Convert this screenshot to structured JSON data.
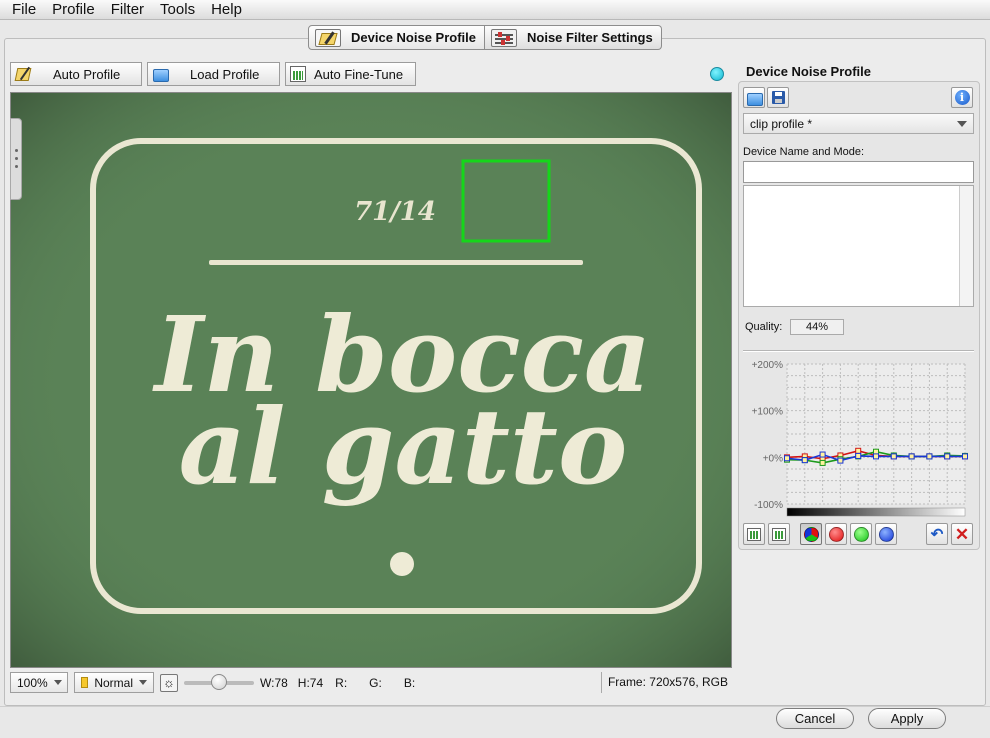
{
  "menu": [
    "File",
    "Profile",
    "Filter",
    "Tools",
    "Help"
  ],
  "tabs": [
    {
      "label": "Device Noise Profile",
      "icon": "device-profile-icon",
      "selected": true
    },
    {
      "label": "Noise Filter Settings",
      "icon": "sliders-icon",
      "selected": false
    }
  ],
  "toolbar": {
    "auto_profile": "Auto Profile",
    "load_profile": "Load Profile",
    "auto_fine_tune": "Auto Fine-Tune"
  },
  "status_dot_color": "#10b6d0",
  "viewer": {
    "image_text": {
      "fraction": "71/14",
      "line1": "In bocca",
      "line2": "al gatto"
    },
    "zoom": "100%",
    "mode": "Normal",
    "brightness_slider": 0.5,
    "sample_width": "W:78",
    "sample_height": "H:74",
    "r_label": "R:",
    "g_label": "G:",
    "b_label": "B:",
    "frame_info": "Frame: 720x576, RGB"
  },
  "panel": {
    "title": "Device Noise Profile",
    "profile_select": "clip profile *",
    "device_label": "Device Name and Mode:",
    "device_value": "",
    "notes_value": "",
    "quality_label": "Quality:",
    "quality_value": "44%"
  },
  "chart_data": {
    "type": "line",
    "y_tick_labels": [
      "+200%",
      "+100%",
      "+0%",
      "-100%"
    ],
    "ylim": [
      -100,
      200
    ],
    "grid": true,
    "x": [
      0,
      1,
      2,
      3,
      4,
      5,
      6,
      7,
      8,
      9,
      10
    ],
    "series": [
      {
        "color": "#d01515",
        "values": [
          0,
          2,
          -3,
          4,
          14,
          4,
          2,
          2,
          2,
          2,
          2
        ]
      },
      {
        "color": "#1c9a1c",
        "values": [
          -5,
          -6,
          -12,
          -4,
          2,
          12,
          4,
          2,
          2,
          4,
          3
        ]
      },
      {
        "color": "#1a36d8",
        "values": [
          -2,
          -6,
          6,
          -7,
          3,
          2,
          2,
          2,
          2,
          2,
          2
        ]
      }
    ]
  },
  "dialog": {
    "cancel": "Cancel",
    "apply": "Apply"
  }
}
